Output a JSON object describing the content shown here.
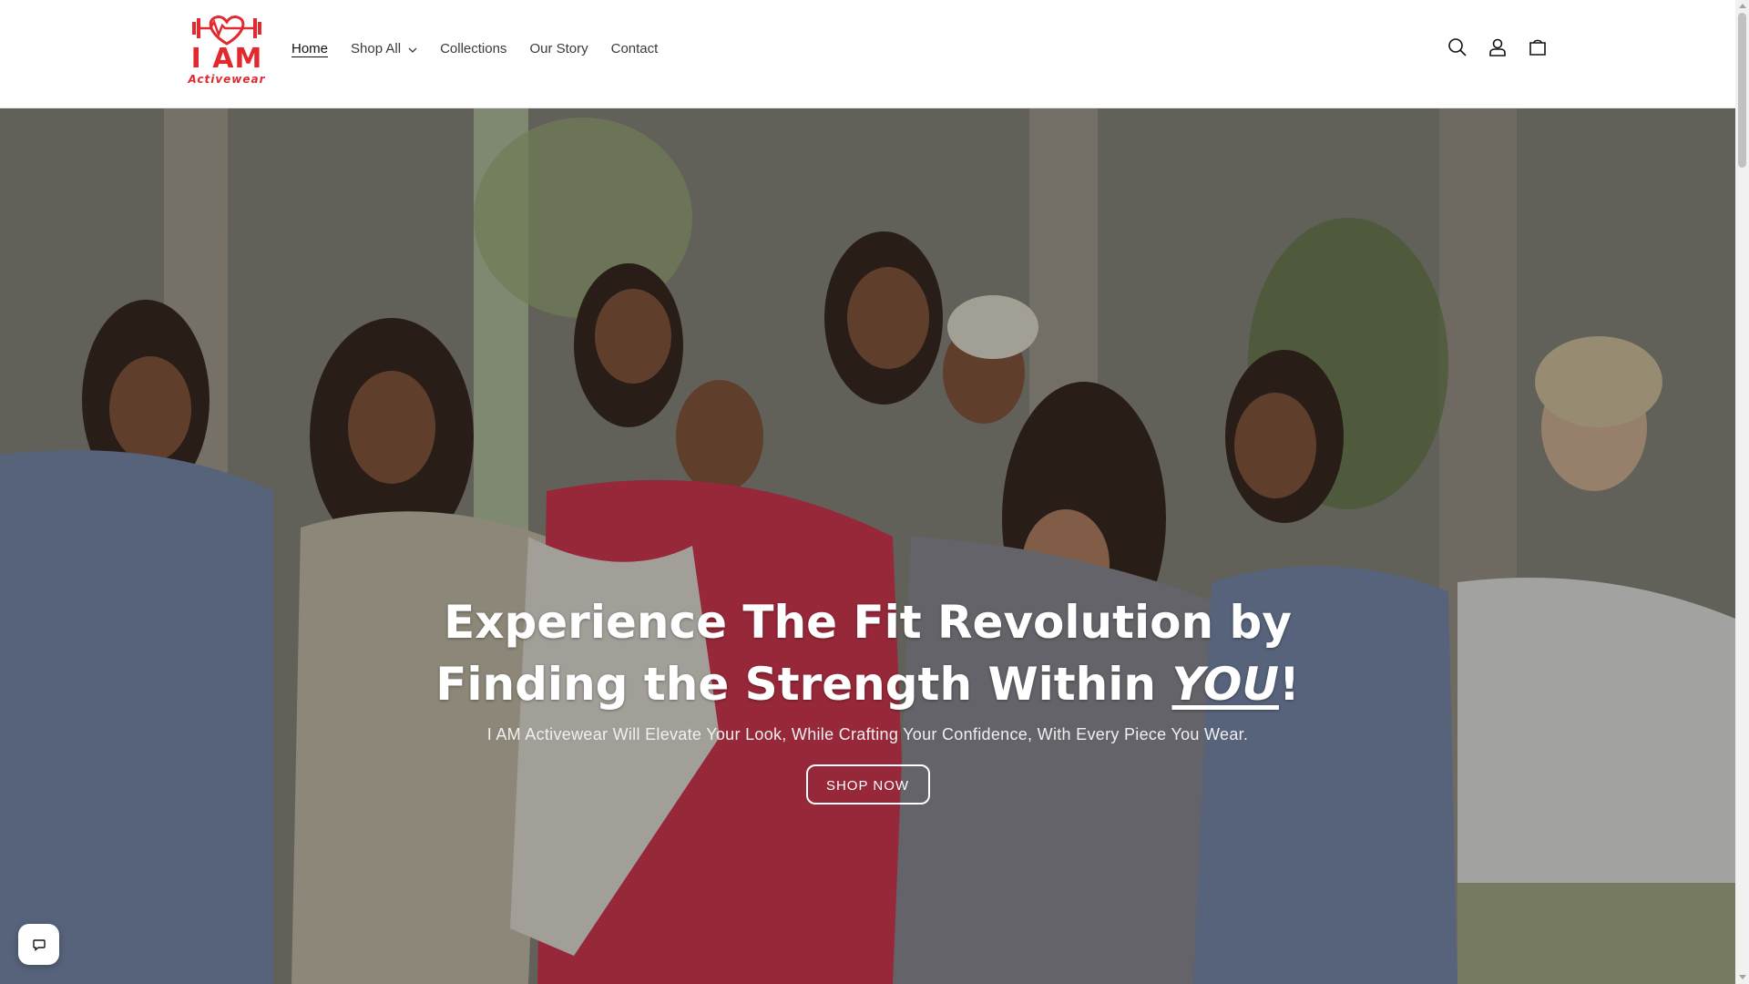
{
  "header": {
    "logo": {
      "main": "I AM",
      "sub": "Activewear",
      "brand_color": "#e02a30"
    },
    "nav": [
      {
        "label": "Home",
        "active": true
      },
      {
        "label": "Shop All",
        "has_dropdown": true
      },
      {
        "label": "Collections"
      },
      {
        "label": "Our Story"
      },
      {
        "label": "Contact"
      }
    ],
    "icons": [
      "search-icon",
      "account-icon",
      "cart-icon"
    ]
  },
  "hero": {
    "heading_line1": "Experience The Fit Revolution by",
    "heading_line2": "Finding the Strength Within",
    "heading_emphasis": "YOU",
    "heading_end": "!",
    "subheading": "I AM Activewear Will Elevate Your Look, While Crafting Your Confidence, With Every Piece You Wear.",
    "button_label": "SHOP NOW"
  },
  "chat": {
    "icon": "chat-icon"
  },
  "colors": {
    "accent": "#e02a30",
    "text": "#121212",
    "nav_text": "#3a3a3a",
    "overlay": "rgba(0,0,0,0.3)"
  }
}
